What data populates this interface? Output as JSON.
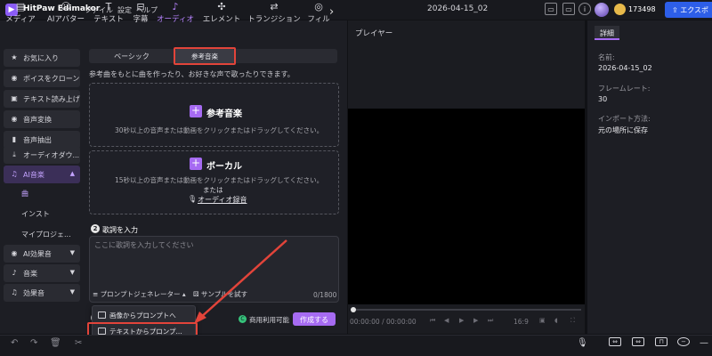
{
  "app": {
    "name": "HitPaw Edimakor",
    "menu": [
      "ファイル",
      "設定",
      "ヘルプ"
    ],
    "project_title": "2026-04-15_02",
    "coins": "173498",
    "export_label": "エクスポ"
  },
  "media_tabs": [
    {
      "label": "メディア",
      "icon": "folder-icon"
    },
    {
      "label": "AIアバター",
      "icon": "avatar-icon"
    },
    {
      "label": "テキスト",
      "icon": "text-icon"
    },
    {
      "label": "字幕",
      "icon": "subtitle-icon"
    },
    {
      "label": "オーディオ",
      "icon": "music-note-icon"
    },
    {
      "label": "エレメント",
      "icon": "element-icon"
    },
    {
      "label": "トランジション",
      "icon": "transition-icon"
    },
    {
      "label": "フィル",
      "icon": "filter-icon"
    }
  ],
  "sidebar": {
    "items": [
      {
        "label": "お気に入り",
        "icon": "star-icon"
      },
      {
        "label": "ボイスをクローン",
        "icon": "clone-icon"
      },
      {
        "label": "テキスト読み上げ",
        "icon": "tts-icon"
      },
      {
        "label": "音声変換",
        "icon": "voice-change-icon"
      },
      {
        "label": "音声抽出",
        "icon": "extract-icon"
      },
      {
        "label": "オーディオダウ...",
        "icon": "download-icon"
      },
      {
        "label": "AI音楽",
        "icon": "ai-music-icon"
      },
      {
        "label": "AI効果音",
        "icon": "ai-sfx-icon"
      },
      {
        "label": "音楽",
        "icon": "music-icon"
      },
      {
        "label": "効果音",
        "icon": "sfx-icon"
      }
    ],
    "sub_items": [
      "曲",
      "インスト",
      "マイプロジェ..."
    ]
  },
  "content": {
    "segment_basic": "ベーシック",
    "segment_reference": "参考音楽",
    "description": "参考曲をもとに曲を作ったり、お好きな声で歌ったりできます。",
    "ref_title": "参考音楽",
    "ref_sub": "30秒以上の音声または動画をクリックまたはドラッグしてください。",
    "vocal_title": "ボーカル",
    "vocal_sub": "15秒以上の音声または動画をクリックまたはドラッグしてください。",
    "or_label": "または",
    "audio_record": "オーディオ録音",
    "lyrics_step": "2",
    "lyrics_label": "歌詞を入力",
    "lyrics_placeholder": "ここに歌詞を入力してください",
    "prompt_generator": "プロンプトジェネレーター",
    "sample_try": "サンプルを試す",
    "char_count": "0/1800",
    "commercial": "商用利用可能",
    "create_button": "作成する"
  },
  "popup_menu": {
    "items": [
      "画像からプロンプトへ",
      "テキストからプロンプ..."
    ]
  },
  "player": {
    "label": "プレイヤー",
    "time": "00:00:00 / 00:00:00",
    "aspect": "16:9"
  },
  "details": {
    "tab": "詳細",
    "name_label": "名前:",
    "name_value": "2026-04-15_02",
    "framerate_label": "フレームレート:",
    "framerate_value": "30",
    "import_label": "インポート方法:",
    "import_value": "元の場所に保存"
  },
  "colors": {
    "accent": "#a66bf2",
    "highlight": "#e2443a",
    "export": "#2d5ee8"
  }
}
